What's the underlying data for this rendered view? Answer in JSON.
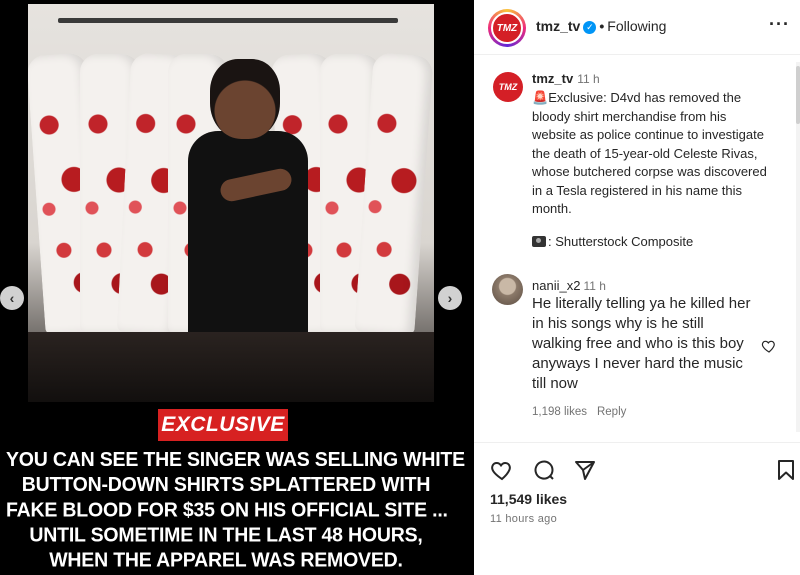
{
  "media": {
    "exclusive_label": "EXCLUSIVE",
    "caption_lines": [
      "YOU CAN SEE THE SINGER WAS SELLING WHITE",
      "BUTTON-DOWN SHIRTS SPLATTERED WITH",
      "FAKE BLOOD FOR $35 ON HIS OFFICIAL SITE ...",
      "UNTIL SOMETIME IN THE LAST 48 HOURS,",
      "WHEN THE APPAREL WAS REMOVED."
    ],
    "prev_icon": "chevron-left-icon",
    "next_icon": "chevron-right-icon",
    "prev_glyph": "‹",
    "next_glyph": "›"
  },
  "header": {
    "avatar_text": "TMZ",
    "username": "tmz_tv",
    "verified_glyph": "✓",
    "separator": "•",
    "follow_status": "Following",
    "more_glyph": "···"
  },
  "caption": {
    "avatar_text": "TMZ",
    "username": "tmz_tv",
    "time": "11 h",
    "siren_glyph": "🚨",
    "text": "Exclusive: D4vd has removed the bloody shirt merchandise from his website as police continue to investigate the death of 15-year-old Celeste Rivas, whose butchered corpse was discovered in a Tesla registered in his name this month.",
    "credit": ": Shutterstock Composite"
  },
  "comment": {
    "username": "nanii_x2",
    "time": "11 h",
    "text": "He literally telling ya he killed her in his songs why is he still walking free and who is this boy anyways I never hard the music till now",
    "likes": "1,198 likes",
    "reply": "Reply"
  },
  "actions": {
    "likes": "11,549 likes",
    "ago": "11 hours ago"
  },
  "colors": {
    "accent_red": "#d72121",
    "verified_blue": "#0095f6",
    "muted_text": "#737373"
  }
}
